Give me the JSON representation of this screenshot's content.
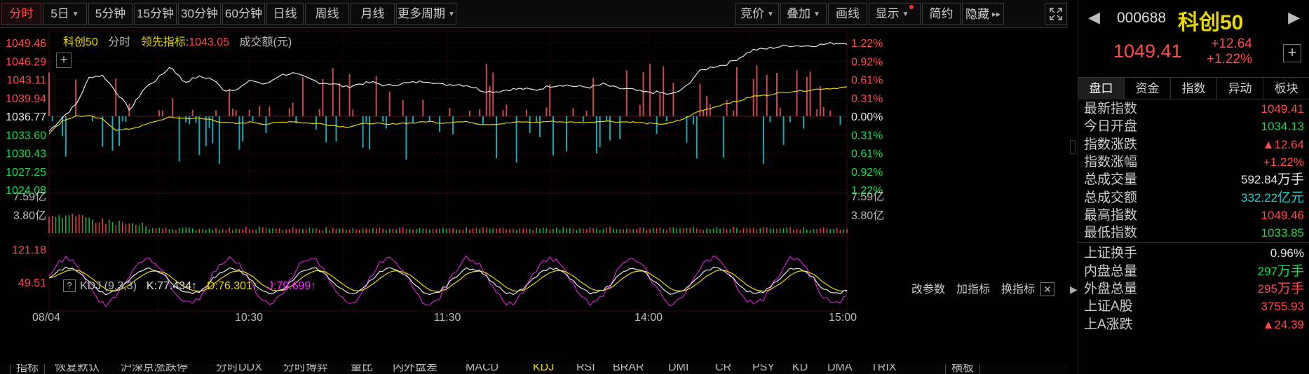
{
  "toolbar": {
    "left": [
      {
        "label": "分时",
        "active": true
      },
      {
        "label": "5日",
        "dropdown": true
      },
      {
        "label": "5分钟"
      },
      {
        "label": "15分钟"
      },
      {
        "label": "30分钟"
      },
      {
        "label": "60分钟"
      },
      {
        "label": "日线"
      },
      {
        "label": "周线"
      },
      {
        "label": "月线"
      },
      {
        "label": "更多周期",
        "dropdown": true
      }
    ],
    "right": [
      {
        "label": "竞价",
        "dropdown": true
      },
      {
        "label": "叠加",
        "dropdown": true
      },
      {
        "label": "画线"
      },
      {
        "label": "显示",
        "dropdown": true,
        "dot": true
      },
      {
        "label": "简约"
      },
      {
        "label": "隐藏"
      }
    ],
    "hide_arrows": "▸▸",
    "fullscreen_icon": "fullscreen-icon"
  },
  "legend": {
    "name": "科创50",
    "mode": "分时",
    "leading_label": "领先指标:",
    "leading_value": "1043.05",
    "turnover_label": "成交额(元)"
  },
  "kdj": {
    "help": "?",
    "title": "KDJ (9,3,3)",
    "k": "K:77.434↑",
    "d": "D:76.301↑",
    "j": "J:79.699↑",
    "actions": [
      "改参数",
      "加指标",
      "换指标"
    ],
    "close": "✕"
  },
  "bottom_tabs": [
    "指标",
    "恢复默认",
    "沪深京涨跌停",
    "分时DDX",
    "分时博弈",
    "量比",
    "内外盘差",
    "MACD",
    "KDJ",
    "RSI",
    "BRAR",
    "DMI",
    "CR",
    "PSY",
    "KD",
    "DMA",
    "TRIX",
    "横板"
  ],
  "chart_data": {
    "type": "line",
    "price_axis_left": [
      "1049.46",
      "1046.29",
      "1043.11",
      "1039.94",
      "1036.77",
      "1033.60",
      "1030.43",
      "1027.25",
      "1024.08"
    ],
    "pct_axis_right": [
      "1.22%",
      "0.92%",
      "0.61%",
      "0.31%",
      "0.00%",
      "0.31%",
      "0.61%",
      "0.92%",
      "1.22%"
    ],
    "pre_close": 1036.77,
    "ylim": [
      1024.08,
      1049.46
    ],
    "volume_axis": [
      "7.59亿",
      "3.80亿"
    ],
    "kdj_axis": [
      "121.18",
      "49.51"
    ],
    "time_labels": [
      "08/04",
      "10:30",
      "11:30",
      "14:00",
      "15:00"
    ],
    "price_series": {
      "name": "科创50",
      "color": "#e6e6e6",
      "values": [
        1034.2,
        1036.6,
        1038.8,
        1043.6,
        1043.8,
        1040.9,
        1037.8,
        1041.5,
        1043.2,
        1045.4,
        1042.6,
        1043.6,
        1043.3,
        1041.2,
        1041.6,
        1043.0,
        1042.2,
        1043.8,
        1044.2,
        1043.4,
        1042.6,
        1042.4,
        1041.8,
        1042.4,
        1042.6,
        1042.0,
        1042.4,
        1042.6,
        1042.9,
        1042.2,
        1042.3,
        1042.1,
        1041.2,
        1041.0,
        1041.4,
        1041.5,
        1041.3,
        1042.0,
        1042.2,
        1041.9,
        1041.8,
        1042.3,
        1041.6,
        1041.4,
        1040.9,
        1040.9,
        1040.5,
        1041.6,
        1044.4,
        1045.3,
        1045.7,
        1046.8,
        1048.2,
        1048.4,
        1048.8,
        1049.0,
        1048.9,
        1049.1,
        1049.4,
        1049.41
      ],
      "color_hex": "#e6e6e6"
    },
    "leading_series": {
      "name": "领先指标",
      "color": "#e8d800",
      "values": [
        1033.8,
        1036.0,
        1036.8,
        1036.8,
        1036.2,
        1034.3,
        1034.6,
        1035.2,
        1036.0,
        1036.6,
        1036.4,
        1036.4,
        1036.2,
        1035.6,
        1035.5,
        1035.8,
        1035.4,
        1035.7,
        1035.9,
        1035.6,
        1035.5,
        1035.2,
        1034.9,
        1035.4,
        1035.6,
        1035.3,
        1035.6,
        1035.6,
        1035.9,
        1035.6,
        1035.8,
        1035.8,
        1035.4,
        1035.4,
        1035.6,
        1035.8,
        1035.7,
        1035.9,
        1035.8,
        1035.7,
        1035.7,
        1036.0,
        1035.8,
        1035.8,
        1035.6,
        1035.4,
        1035.6,
        1036.4,
        1037.6,
        1038.2,
        1039.0,
        1039.4,
        1040.2,
        1040.4,
        1040.8,
        1041.1,
        1041.2,
        1041.5,
        1041.6,
        1041.8
      ]
    }
  },
  "panel": {
    "code": "000688",
    "name": "科创50",
    "price": "1049.41",
    "change": "+12.64",
    "change_pct": "+1.22%",
    "nav_prev": "◀",
    "nav_next": "▶",
    "add": "+",
    "tabs": [
      {
        "label": "盘口",
        "active": true
      },
      {
        "label": "资金"
      },
      {
        "label": "指数"
      },
      {
        "label": "异动"
      },
      {
        "label": "板块"
      }
    ],
    "rows": [
      {
        "label": "最新指数",
        "value": "1049.41",
        "color": "#ff4a4a"
      },
      {
        "label": "今日开盘",
        "value": "1034.13",
        "color": "#19d84a"
      },
      {
        "label": "指数涨跌",
        "value": "▲12.64",
        "color": "#ff4a4a"
      },
      {
        "label": "指数涨幅",
        "value": "+1.22%",
        "color": "#ff4a4a"
      },
      {
        "label": "总成交量",
        "value": "592.84",
        "unit": "万手",
        "color": "#e6e6e6"
      },
      {
        "label": "总成交额",
        "value": "332.22",
        "unit": "亿元",
        "color": "#19d0d0"
      },
      {
        "label": "最高指数",
        "value": "1049.46",
        "color": "#ff4a4a"
      },
      {
        "label": "最低指数",
        "value": "1033.85",
        "color": "#19d84a"
      },
      {
        "label": "上证换手",
        "value": "0.96%",
        "color": "#e6e6e6"
      },
      {
        "label": "内盘总量",
        "value": "297",
        "unit": "万手",
        "color": "#19d84a"
      },
      {
        "label": "外盘总量",
        "value": "295",
        "unit": "万手",
        "color": "#ff4a4a"
      },
      {
        "label": "上证A股",
        "value": "3755.93",
        "color": "#ff4a4a"
      },
      {
        "label": "上A涨跌",
        "value": "▲24.39",
        "color": "#ff4a4a"
      }
    ]
  }
}
